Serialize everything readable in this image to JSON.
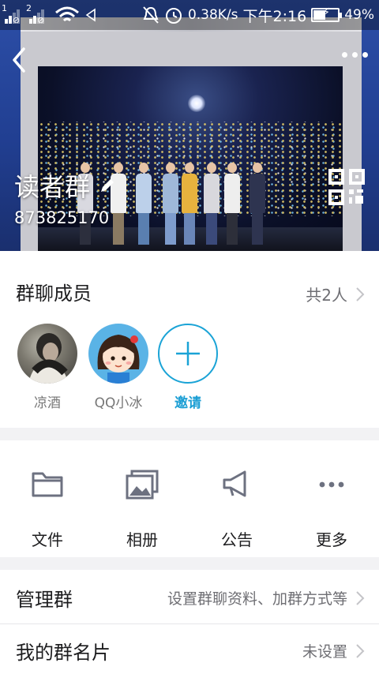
{
  "status_bar": {
    "sim1": "1",
    "sim2": "2",
    "speed": "0.38K/s",
    "time": "下午2:16",
    "battery": "49%",
    "battery_level": 0.49
  },
  "header": {
    "banner_text": "...................",
    "group_name": "读者群",
    "group_id": "873825170"
  },
  "members": {
    "title": "群聊成员",
    "count": "共2人",
    "list": [
      {
        "name": "凉酒"
      },
      {
        "name": "QQ小冰"
      }
    ],
    "invite_label": "邀请"
  },
  "actions": [
    {
      "label": "文件",
      "icon": "folder-icon"
    },
    {
      "label": "相册",
      "icon": "photo-album-icon"
    },
    {
      "label": "公告",
      "icon": "megaphone-icon"
    },
    {
      "label": "更多",
      "icon": "more-dots-icon"
    }
  ],
  "manage": {
    "title": "管理群",
    "hint": "设置群聊资料、加群方式等"
  },
  "name_card": {
    "title": "我的群名片",
    "value": "未设置"
  },
  "colors": {
    "accent": "#1aa3d6",
    "header_blue": "#213f92",
    "icon_gray": "#6d7180"
  }
}
